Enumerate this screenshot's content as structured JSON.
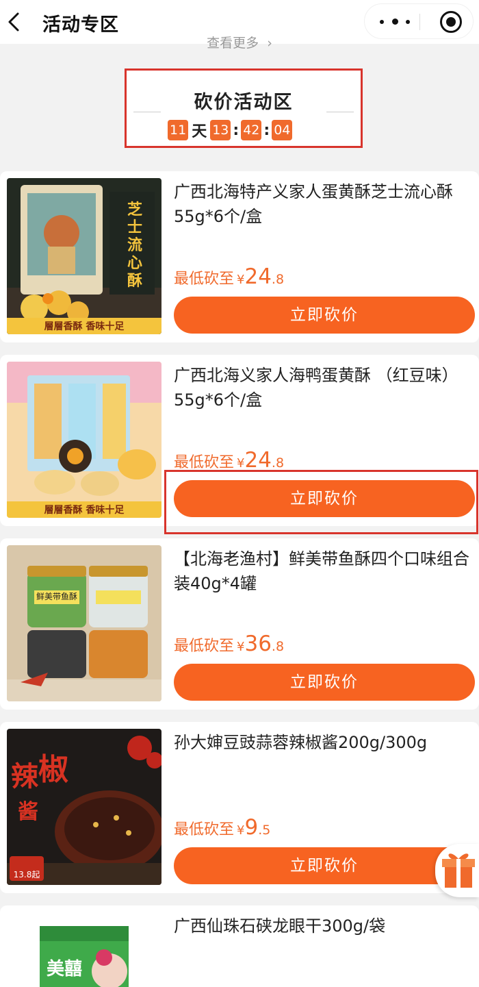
{
  "header": {
    "title": "活动专区"
  },
  "see_more": {
    "label": "查看更多",
    "arrow": "›"
  },
  "activity": {
    "title": "砍价活动区",
    "countdown": {
      "days": "11",
      "day_unit": "天",
      "hours": "13",
      "minutes": "42",
      "seconds": "04",
      "colon": ":"
    }
  },
  "products": [
    {
      "name": "广西北海特产义家人蛋黄酥芝士流心酥55g*6个/盒",
      "price_label": "最低砍至",
      "currency": "¥",
      "price_int": "24",
      "price_dec": ".8",
      "button": "立即砍价"
    },
    {
      "name": "广西北海义家人海鸭蛋黄酥 （红豆味）55g*6个/盒",
      "price_label": "最低砍至",
      "currency": "¥",
      "price_int": "24",
      "price_dec": ".8",
      "button": "立即砍价"
    },
    {
      "name": "【北海老渔村】鲜美带鱼酥四个口味组合装40g*4罐",
      "price_label": "最低砍至",
      "currency": "¥",
      "price_int": "36",
      "price_dec": ".8",
      "button": "立即砍价"
    },
    {
      "name": "孙大婶豆豉蒜蓉辣椒酱200g/300g",
      "price_label": "最低砍至",
      "currency": "¥",
      "price_int": "9",
      "price_dec": ".5",
      "button": "立即砍价"
    },
    {
      "name": "广西仙珠石硖龙眼干300g/袋"
    }
  ],
  "image_texts": {
    "p1_vertical": "芝士流心酥",
    "p1_bottom": "層層香酥  香味十足",
    "p2_bottom": "層層香酥  香味十足",
    "p3_jar": "鲜美带鱼酥",
    "p4_big1": "辣",
    "p4_big2": "椒",
    "p4_big3": "酱",
    "p4_tag": "13.8起",
    "p5_brand": "美囍"
  },
  "colors": {
    "accent": "#f76321",
    "countdown_bg": "#f06a2c",
    "highlight": "#d8342c"
  }
}
